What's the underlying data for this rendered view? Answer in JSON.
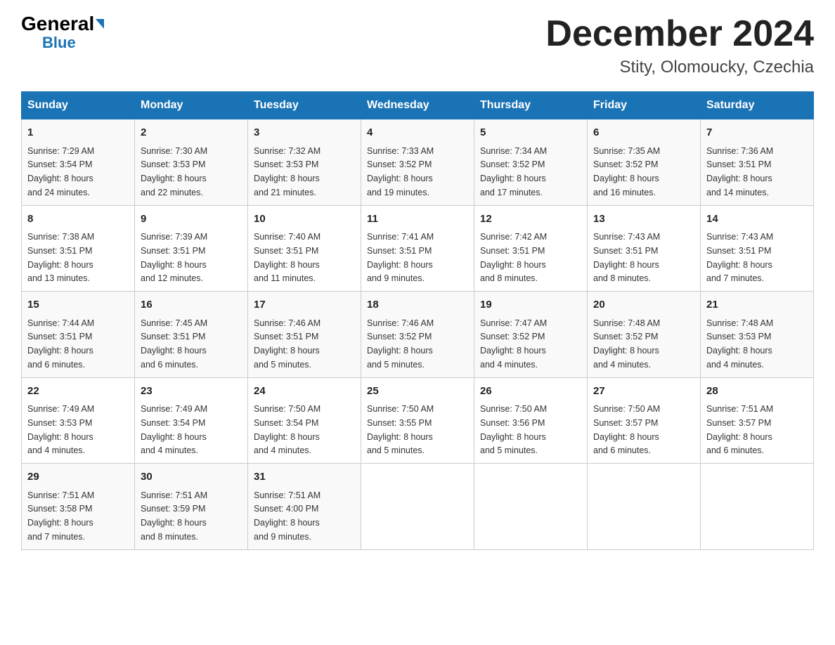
{
  "logo": {
    "general": "General",
    "triangle": "",
    "blue": "Blue"
  },
  "title": "December 2024",
  "subtitle": "Stity, Olomoucky, Czechia",
  "days_of_week": [
    "Sunday",
    "Monday",
    "Tuesday",
    "Wednesday",
    "Thursday",
    "Friday",
    "Saturday"
  ],
  "weeks": [
    [
      {
        "day": "1",
        "sunrise": "7:29 AM",
        "sunset": "3:54 PM",
        "daylight": "8 hours and 24 minutes."
      },
      {
        "day": "2",
        "sunrise": "7:30 AM",
        "sunset": "3:53 PM",
        "daylight": "8 hours and 22 minutes."
      },
      {
        "day": "3",
        "sunrise": "7:32 AM",
        "sunset": "3:53 PM",
        "daylight": "8 hours and 21 minutes."
      },
      {
        "day": "4",
        "sunrise": "7:33 AM",
        "sunset": "3:52 PM",
        "daylight": "8 hours and 19 minutes."
      },
      {
        "day": "5",
        "sunrise": "7:34 AM",
        "sunset": "3:52 PM",
        "daylight": "8 hours and 17 minutes."
      },
      {
        "day": "6",
        "sunrise": "7:35 AM",
        "sunset": "3:52 PM",
        "daylight": "8 hours and 16 minutes."
      },
      {
        "day": "7",
        "sunrise": "7:36 AM",
        "sunset": "3:51 PM",
        "daylight": "8 hours and 14 minutes."
      }
    ],
    [
      {
        "day": "8",
        "sunrise": "7:38 AM",
        "sunset": "3:51 PM",
        "daylight": "8 hours and 13 minutes."
      },
      {
        "day": "9",
        "sunrise": "7:39 AM",
        "sunset": "3:51 PM",
        "daylight": "8 hours and 12 minutes."
      },
      {
        "day": "10",
        "sunrise": "7:40 AM",
        "sunset": "3:51 PM",
        "daylight": "8 hours and 11 minutes."
      },
      {
        "day": "11",
        "sunrise": "7:41 AM",
        "sunset": "3:51 PM",
        "daylight": "8 hours and 9 minutes."
      },
      {
        "day": "12",
        "sunrise": "7:42 AM",
        "sunset": "3:51 PM",
        "daylight": "8 hours and 8 minutes."
      },
      {
        "day": "13",
        "sunrise": "7:43 AM",
        "sunset": "3:51 PM",
        "daylight": "8 hours and 8 minutes."
      },
      {
        "day": "14",
        "sunrise": "7:43 AM",
        "sunset": "3:51 PM",
        "daylight": "8 hours and 7 minutes."
      }
    ],
    [
      {
        "day": "15",
        "sunrise": "7:44 AM",
        "sunset": "3:51 PM",
        "daylight": "8 hours and 6 minutes."
      },
      {
        "day": "16",
        "sunrise": "7:45 AM",
        "sunset": "3:51 PM",
        "daylight": "8 hours and 6 minutes."
      },
      {
        "day": "17",
        "sunrise": "7:46 AM",
        "sunset": "3:51 PM",
        "daylight": "8 hours and 5 minutes."
      },
      {
        "day": "18",
        "sunrise": "7:46 AM",
        "sunset": "3:52 PM",
        "daylight": "8 hours and 5 minutes."
      },
      {
        "day": "19",
        "sunrise": "7:47 AM",
        "sunset": "3:52 PM",
        "daylight": "8 hours and 4 minutes."
      },
      {
        "day": "20",
        "sunrise": "7:48 AM",
        "sunset": "3:52 PM",
        "daylight": "8 hours and 4 minutes."
      },
      {
        "day": "21",
        "sunrise": "7:48 AM",
        "sunset": "3:53 PM",
        "daylight": "8 hours and 4 minutes."
      }
    ],
    [
      {
        "day": "22",
        "sunrise": "7:49 AM",
        "sunset": "3:53 PM",
        "daylight": "8 hours and 4 minutes."
      },
      {
        "day": "23",
        "sunrise": "7:49 AM",
        "sunset": "3:54 PM",
        "daylight": "8 hours and 4 minutes."
      },
      {
        "day": "24",
        "sunrise": "7:50 AM",
        "sunset": "3:54 PM",
        "daylight": "8 hours and 4 minutes."
      },
      {
        "day": "25",
        "sunrise": "7:50 AM",
        "sunset": "3:55 PM",
        "daylight": "8 hours and 5 minutes."
      },
      {
        "day": "26",
        "sunrise": "7:50 AM",
        "sunset": "3:56 PM",
        "daylight": "8 hours and 5 minutes."
      },
      {
        "day": "27",
        "sunrise": "7:50 AM",
        "sunset": "3:57 PM",
        "daylight": "8 hours and 6 minutes."
      },
      {
        "day": "28",
        "sunrise": "7:51 AM",
        "sunset": "3:57 PM",
        "daylight": "8 hours and 6 minutes."
      }
    ],
    [
      {
        "day": "29",
        "sunrise": "7:51 AM",
        "sunset": "3:58 PM",
        "daylight": "8 hours and 7 minutes."
      },
      {
        "day": "30",
        "sunrise": "7:51 AM",
        "sunset": "3:59 PM",
        "daylight": "8 hours and 8 minutes."
      },
      {
        "day": "31",
        "sunrise": "7:51 AM",
        "sunset": "4:00 PM",
        "daylight": "8 hours and 9 minutes."
      },
      null,
      null,
      null,
      null
    ]
  ],
  "labels": {
    "sunrise": "Sunrise:",
    "sunset": "Sunset:",
    "daylight": "Daylight:"
  }
}
